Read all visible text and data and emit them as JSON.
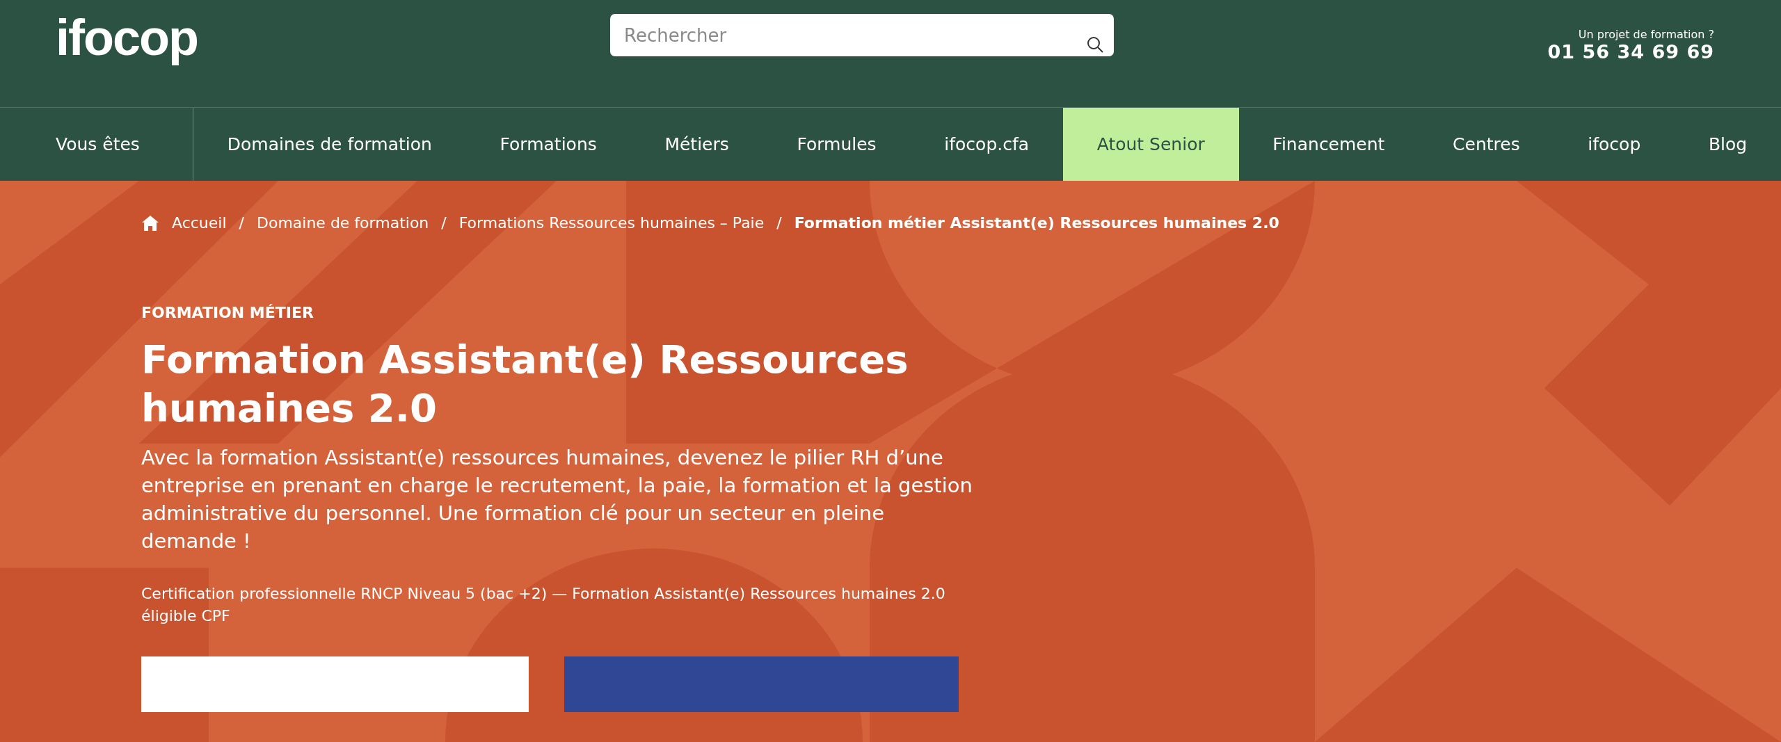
{
  "header": {
    "logo": "ifocop",
    "search": {
      "placeholder": "Rechercher"
    },
    "contact_label": "Un projet de formation ?",
    "phone": "01 56 34 69 69"
  },
  "nav": [
    {
      "label": "Vous êtes",
      "selected": false
    },
    {
      "label": "Domaines de formation",
      "selected": false
    },
    {
      "label": "Formations",
      "selected": false
    },
    {
      "label": "Métiers",
      "selected": false
    },
    {
      "label": "Formules",
      "selected": false
    },
    {
      "label": "ifocop.cfa",
      "selected": false
    },
    {
      "label": "Atout Senior",
      "selected": true
    },
    {
      "label": "Financement",
      "selected": false
    },
    {
      "label": "Centres",
      "selected": false
    },
    {
      "label": "ifocop",
      "selected": false
    },
    {
      "label": "Blog",
      "selected": false
    }
  ],
  "breadcrumb": [
    {
      "label": "Accueil",
      "current": false
    },
    {
      "label": "Domaine de formation",
      "current": false
    },
    {
      "label": "Formations Ressources humaines – Paie",
      "current": false
    },
    {
      "label": "Formation métier Assistant(e) Ressources humaines 2.0",
      "current": true
    }
  ],
  "breadcrumb_separator": "/",
  "hero": {
    "kicker": "FORMATION MÉTIER",
    "title": "Formation Assistant(e) Ressources humaines 2.0",
    "intro": "Avec la formation Assistant(e) ressources humaines, devenez le pilier RH d’une entreprise en prenant en charge le recrutement, la paie, la formation et la gestion administrative du personnel. Une formation clé pour un secteur en pleine demande !",
    "certification": "Certification professionnelle RNCP Niveau 5 (bac +2) — Formation Assistant(e) Ressources humaines 2.0 éligible CPF",
    "buttons": [
      {
        "kind": "light"
      },
      {
        "kind": "dark"
      }
    ]
  }
}
